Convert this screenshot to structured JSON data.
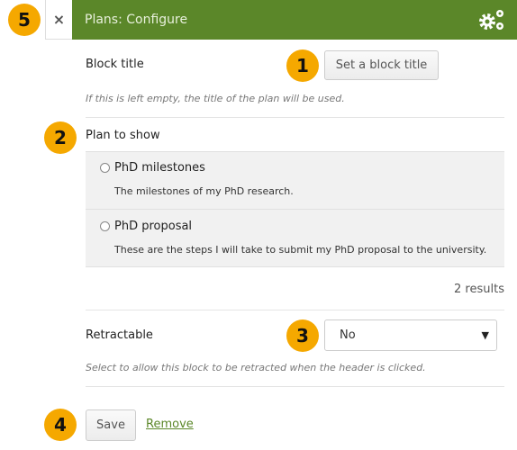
{
  "header": {
    "title": "Plans: Configure",
    "close_icon": "×",
    "settings_icon": "gears-icon",
    "color": "#5b8729"
  },
  "badges": [
    "1",
    "2",
    "3",
    "4",
    "5"
  ],
  "block_title": {
    "label": "Block title",
    "button": "Set a block title",
    "help": "If this is left empty, the title of the plan will be used."
  },
  "plan": {
    "label": "Plan to show",
    "items": [
      {
        "title": "PhD milestones",
        "description": "The milestones of my PhD research."
      },
      {
        "title": "PhD proposal",
        "description": "These are the steps I will take to submit my PhD proposal to the university."
      }
    ],
    "results": "2 results"
  },
  "retractable": {
    "label": "Retractable",
    "value": "No",
    "caret": "▼",
    "help": "Select to allow this block to be retracted when the header is clicked."
  },
  "actions": {
    "save": "Save",
    "remove": "Remove"
  }
}
